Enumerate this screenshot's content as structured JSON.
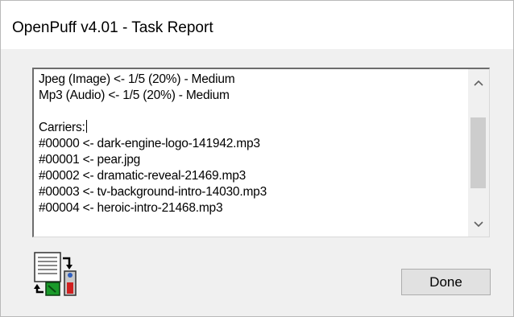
{
  "window": {
    "title": "OpenPuff v4.01 - Task Report"
  },
  "report": {
    "lines": [
      "Jpeg (Image) <- 1/5 (20%) - Medium",
      "Mp3 (Audio) <- 1/5 (20%) - Medium",
      "",
      "Carriers:",
      "#00000 <- dark-engine-logo-141942.mp3",
      "#00001 <- pear.jpg",
      "#00002 <- dramatic-reveal-21469.mp3",
      "#00003 <- tv-background-intro-14030.mp3",
      "#00004 <- heroic-intro-21468.mp3"
    ]
  },
  "scrollbar": {
    "up_glyph": "^",
    "down_glyph": "v"
  },
  "icon": {
    "name": "report-icon"
  },
  "buttons": {
    "done_label": "Done"
  }
}
